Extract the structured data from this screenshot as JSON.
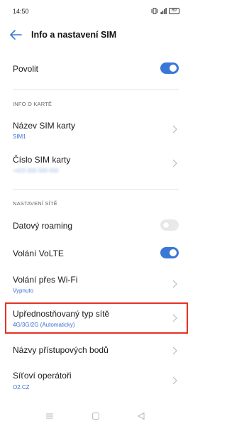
{
  "status_bar": {
    "time": "14:50",
    "battery": "69"
  },
  "header": {
    "title": "Info a nastavení SIM"
  },
  "enable_row": {
    "label": "Povolit",
    "toggle_on": true
  },
  "card_info": {
    "section_label": "INFO O KARTĚ",
    "sim_name_label": "Název SIM karty",
    "sim_name_value": "SIM1",
    "sim_number_label": "Číslo SIM karty",
    "sim_number_value": "+420 000 000 000"
  },
  "network_settings": {
    "section_label": "NASTAVENÍ SÍTĚ",
    "data_roaming_label": "Datový roaming",
    "data_roaming_on": false,
    "volte_label": "Volání VoLTE",
    "volte_on": true,
    "wifi_calling_label": "Volání přes Wi-Fi",
    "wifi_calling_value": "Vypnuto",
    "preferred_network_label": "Upřednostňovaný typ sítě",
    "preferred_network_value": "4G/3G/2G (Automaticky)",
    "apn_label": "Názvy přístupových bodů",
    "operators_label": "Síťoví operátoři",
    "operators_value": "O2.CZ"
  },
  "colors": {
    "accent": "#3a78d8",
    "highlight": "#e53222"
  }
}
